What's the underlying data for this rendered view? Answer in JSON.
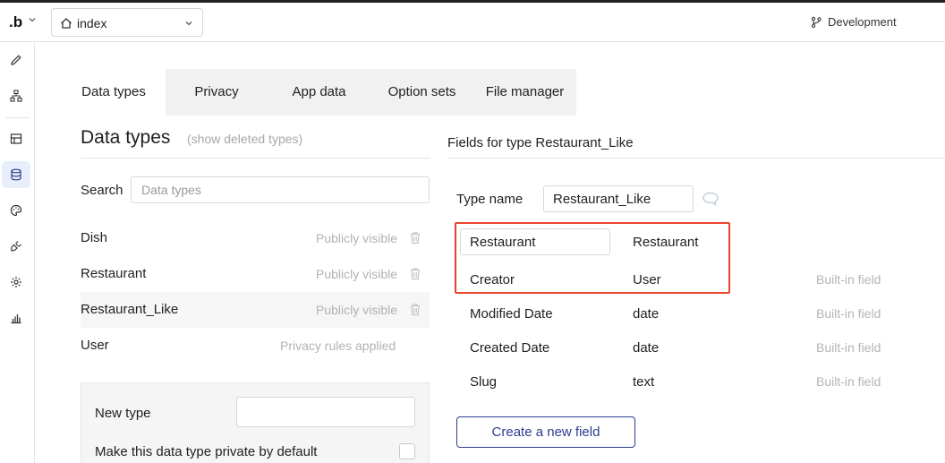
{
  "app": {
    "logo": ".b"
  },
  "topbar": {
    "page_name": "index",
    "environment": "Development"
  },
  "tabs": [
    {
      "label": "Data types",
      "active": true
    },
    {
      "label": "Privacy"
    },
    {
      "label": "App data"
    },
    {
      "label": "Option sets"
    },
    {
      "label": "File manager"
    }
  ],
  "data_types": {
    "title": "Data types",
    "show_deleted": "(show deleted types)",
    "search_label": "Search",
    "search_placeholder": "Data types",
    "items": [
      {
        "name": "Dish",
        "visibility": "Publicly visible"
      },
      {
        "name": "Restaurant",
        "visibility": "Publicly visible"
      },
      {
        "name": "Restaurant_Like",
        "visibility": "Publicly visible"
      },
      {
        "name": "User",
        "visibility": "Privacy rules applied"
      }
    ],
    "new_type_label": "New type",
    "private_label": "Make this data type private by default"
  },
  "fields": {
    "title": "Fields for type Restaurant_Like",
    "type_name_label": "Type name",
    "type_name_value": "Restaurant_Like",
    "rows": [
      {
        "name": "Restaurant",
        "type": "Restaurant",
        "builtin": ""
      },
      {
        "name": "Creator",
        "type": "User",
        "builtin": "Built-in field"
      },
      {
        "name": "Modified Date",
        "type": "date",
        "builtin": "Built-in field"
      },
      {
        "name": "Created Date",
        "type": "date",
        "builtin": "Built-in field"
      },
      {
        "name": "Slug",
        "type": "text",
        "builtin": "Built-in field"
      }
    ],
    "create_label": "Create a new field"
  },
  "colors": {
    "accent": "#2a3e8e",
    "highlight": "#e8452a",
    "nav_active": "#e9eefb"
  }
}
